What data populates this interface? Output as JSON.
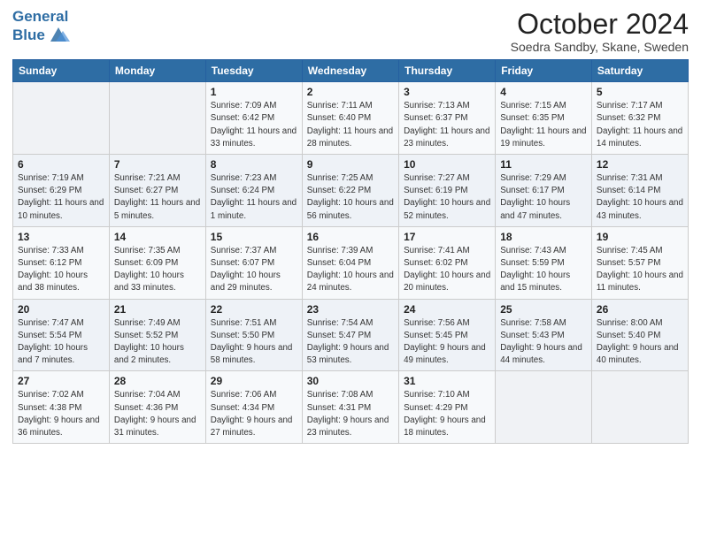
{
  "header": {
    "logo_line1": "General",
    "logo_line2": "Blue",
    "month": "October 2024",
    "location": "Soedra Sandby, Skane, Sweden"
  },
  "weekdays": [
    "Sunday",
    "Monday",
    "Tuesday",
    "Wednesday",
    "Thursday",
    "Friday",
    "Saturday"
  ],
  "weeks": [
    [
      {
        "day": "",
        "info": ""
      },
      {
        "day": "",
        "info": ""
      },
      {
        "day": "1",
        "info": "Sunrise: 7:09 AM\nSunset: 6:42 PM\nDaylight: 11 hours and 33 minutes."
      },
      {
        "day": "2",
        "info": "Sunrise: 7:11 AM\nSunset: 6:40 PM\nDaylight: 11 hours and 28 minutes."
      },
      {
        "day": "3",
        "info": "Sunrise: 7:13 AM\nSunset: 6:37 PM\nDaylight: 11 hours and 23 minutes."
      },
      {
        "day": "4",
        "info": "Sunrise: 7:15 AM\nSunset: 6:35 PM\nDaylight: 11 hours and 19 minutes."
      },
      {
        "day": "5",
        "info": "Sunrise: 7:17 AM\nSunset: 6:32 PM\nDaylight: 11 hours and 14 minutes."
      }
    ],
    [
      {
        "day": "6",
        "info": "Sunrise: 7:19 AM\nSunset: 6:29 PM\nDaylight: 11 hours and 10 minutes."
      },
      {
        "day": "7",
        "info": "Sunrise: 7:21 AM\nSunset: 6:27 PM\nDaylight: 11 hours and 5 minutes."
      },
      {
        "day": "8",
        "info": "Sunrise: 7:23 AM\nSunset: 6:24 PM\nDaylight: 11 hours and 1 minute."
      },
      {
        "day": "9",
        "info": "Sunrise: 7:25 AM\nSunset: 6:22 PM\nDaylight: 10 hours and 56 minutes."
      },
      {
        "day": "10",
        "info": "Sunrise: 7:27 AM\nSunset: 6:19 PM\nDaylight: 10 hours and 52 minutes."
      },
      {
        "day": "11",
        "info": "Sunrise: 7:29 AM\nSunset: 6:17 PM\nDaylight: 10 hours and 47 minutes."
      },
      {
        "day": "12",
        "info": "Sunrise: 7:31 AM\nSunset: 6:14 PM\nDaylight: 10 hours and 43 minutes."
      }
    ],
    [
      {
        "day": "13",
        "info": "Sunrise: 7:33 AM\nSunset: 6:12 PM\nDaylight: 10 hours and 38 minutes."
      },
      {
        "day": "14",
        "info": "Sunrise: 7:35 AM\nSunset: 6:09 PM\nDaylight: 10 hours and 33 minutes."
      },
      {
        "day": "15",
        "info": "Sunrise: 7:37 AM\nSunset: 6:07 PM\nDaylight: 10 hours and 29 minutes."
      },
      {
        "day": "16",
        "info": "Sunrise: 7:39 AM\nSunset: 6:04 PM\nDaylight: 10 hours and 24 minutes."
      },
      {
        "day": "17",
        "info": "Sunrise: 7:41 AM\nSunset: 6:02 PM\nDaylight: 10 hours and 20 minutes."
      },
      {
        "day": "18",
        "info": "Sunrise: 7:43 AM\nSunset: 5:59 PM\nDaylight: 10 hours and 15 minutes."
      },
      {
        "day": "19",
        "info": "Sunrise: 7:45 AM\nSunset: 5:57 PM\nDaylight: 10 hours and 11 minutes."
      }
    ],
    [
      {
        "day": "20",
        "info": "Sunrise: 7:47 AM\nSunset: 5:54 PM\nDaylight: 10 hours and 7 minutes."
      },
      {
        "day": "21",
        "info": "Sunrise: 7:49 AM\nSunset: 5:52 PM\nDaylight: 10 hours and 2 minutes."
      },
      {
        "day": "22",
        "info": "Sunrise: 7:51 AM\nSunset: 5:50 PM\nDaylight: 9 hours and 58 minutes."
      },
      {
        "day": "23",
        "info": "Sunrise: 7:54 AM\nSunset: 5:47 PM\nDaylight: 9 hours and 53 minutes."
      },
      {
        "day": "24",
        "info": "Sunrise: 7:56 AM\nSunset: 5:45 PM\nDaylight: 9 hours and 49 minutes."
      },
      {
        "day": "25",
        "info": "Sunrise: 7:58 AM\nSunset: 5:43 PM\nDaylight: 9 hours and 44 minutes."
      },
      {
        "day": "26",
        "info": "Sunrise: 8:00 AM\nSunset: 5:40 PM\nDaylight: 9 hours and 40 minutes."
      }
    ],
    [
      {
        "day": "27",
        "info": "Sunrise: 7:02 AM\nSunset: 4:38 PM\nDaylight: 9 hours and 36 minutes."
      },
      {
        "day": "28",
        "info": "Sunrise: 7:04 AM\nSunset: 4:36 PM\nDaylight: 9 hours and 31 minutes."
      },
      {
        "day": "29",
        "info": "Sunrise: 7:06 AM\nSunset: 4:34 PM\nDaylight: 9 hours and 27 minutes."
      },
      {
        "day": "30",
        "info": "Sunrise: 7:08 AM\nSunset: 4:31 PM\nDaylight: 9 hours and 23 minutes."
      },
      {
        "day": "31",
        "info": "Sunrise: 7:10 AM\nSunset: 4:29 PM\nDaylight: 9 hours and 18 minutes."
      },
      {
        "day": "",
        "info": ""
      },
      {
        "day": "",
        "info": ""
      }
    ]
  ]
}
